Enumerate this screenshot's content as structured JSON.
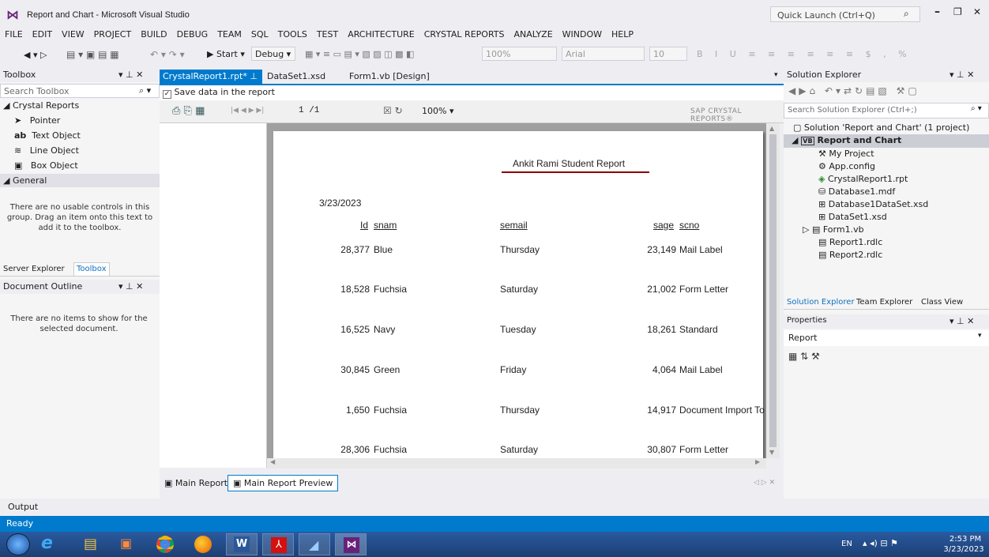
{
  "window": {
    "title": "Report and Chart - Microsoft Visual Studio",
    "quick_launch": "Quick Launch (Ctrl+Q)"
  },
  "menu": [
    "FILE",
    "EDIT",
    "VIEW",
    "PROJECT",
    "BUILD",
    "DEBUG",
    "TEAM",
    "SQL",
    "TOOLS",
    "TEST",
    "ARCHITECTURE",
    "CRYSTAL REPORTS",
    "ANALYZE",
    "WINDOW",
    "HELP"
  ],
  "toolbar": {
    "start": "Start",
    "config": "Debug",
    "zoom": "100%",
    "font": "Arial",
    "size": "10"
  },
  "toolbox": {
    "title": "Toolbox",
    "search": "Search Toolbox",
    "group_crystal": "Crystal Reports",
    "items": [
      "Pointer",
      "Text Object",
      "Line Object",
      "Box Object"
    ],
    "group_general": "General",
    "empty_msg": "There are no usable controls in this group. Drag an item onto this text to add it to the toolbox.",
    "tab_server": "Server Explorer",
    "tab_toolbox": "Toolbox"
  },
  "doc_outline": {
    "title": "Document Outline",
    "empty_msg": "There are no items to show for the selected document."
  },
  "tabs": {
    "active": "CrystalReport1.rpt*",
    "tab2": "DataSet1.xsd",
    "tab3": "Form1.vb [Design]"
  },
  "save_data": "Save data in the report",
  "viewer": {
    "page": "1 /1",
    "zoom": "100%",
    "brand": "SAP CRYSTAL REPORTS®"
  },
  "report": {
    "title": "Ankit Rami Student Report",
    "date": "3/23/2023",
    "headers": {
      "id": "Id",
      "sname": "snam",
      "semail": "semail",
      "sage": "sage",
      "scno": "scno"
    },
    "rows": [
      {
        "id": "28,377",
        "sname": "Blue",
        "semail": "Thursday",
        "sage": "23,149",
        "scno": "Mail Label"
      },
      {
        "id": "18,528",
        "sname": "Fuchsia",
        "semail": "Saturday",
        "sage": "21,002",
        "scno": "Form Letter"
      },
      {
        "id": "16,525",
        "sname": "Navy",
        "semail": "Tuesday",
        "sage": "18,261",
        "scno": "Standard"
      },
      {
        "id": "30,845",
        "sname": "Green",
        "semail": "Friday",
        "sage": "4,064",
        "scno": "Mail Label"
      },
      {
        "id": "1,650",
        "sname": "Fuchsia",
        "semail": "Thursday",
        "sage": "14,917",
        "scno": "Document Import To"
      },
      {
        "id": "28,306",
        "sname": "Fuchsia",
        "semail": "Saturday",
        "sage": "30,807",
        "scno": "Form Letter"
      }
    ]
  },
  "bottom_tabs": {
    "main": "Main Report",
    "preview": "Main Report Preview"
  },
  "solution": {
    "title": "Solution Explorer",
    "search": "Search Solution Explorer (Ctrl+;)",
    "root": "Solution 'Report and Chart' (1 project)",
    "project": "Report and Chart",
    "items": [
      "My Project",
      "App.config",
      "CrystalReport1.rpt",
      "Database1.mdf",
      "Database1DataSet.xsd",
      "DataSet1.xsd",
      "Form1.vb",
      "Report1.rdlc",
      "Report2.rdlc"
    ],
    "tabs": [
      "Solution Explorer",
      "Team Explorer",
      "Class View"
    ]
  },
  "properties": {
    "title": "Properties",
    "object": "Report"
  },
  "output": "Output",
  "status": "Ready",
  "taskbar": {
    "lang": "EN",
    "time": "2:53 PM",
    "date": "3/23/2023"
  },
  "colors": {
    "statusbar": "#007acc",
    "accent": "#007acc",
    "taskbar": "#1c3f73",
    "report_line": "#8b0000"
  }
}
